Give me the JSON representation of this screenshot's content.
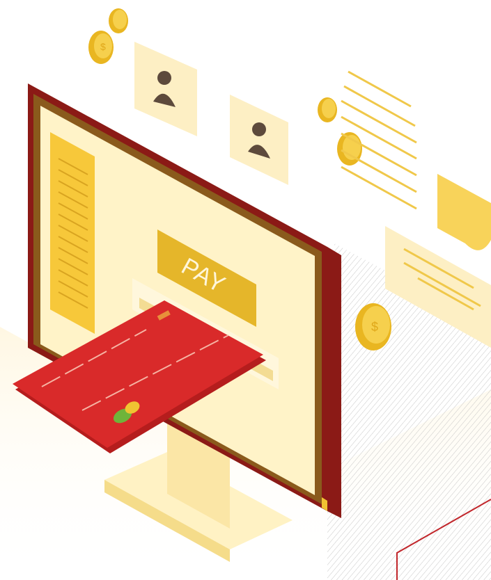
{
  "screen": {
    "pay_button_label": "PAY"
  },
  "colors": {
    "bezel_outer": "#8b1a16",
    "bezel_inner": "#8a5a1c",
    "screen_bg": "#fff3c8",
    "sidebar": "#f7c83a",
    "pay_button": "#e5b62a",
    "card": "#d92a2a",
    "coin": "#f1c232",
    "paper": "#fdefc4",
    "avatar": "#5d4a3c"
  },
  "icons": {
    "coins": [
      "dollar-coin-icon",
      "dollar-coin-icon",
      "dollar-coin-icon",
      "dollar-coin-icon",
      "dollar-coin-icon"
    ],
    "profiles": [
      "user-profile-icon",
      "user-profile-icon"
    ],
    "documents": [
      "document-lines-icon",
      "receipt-icon"
    ],
    "payment": "credit-card-icon"
  }
}
